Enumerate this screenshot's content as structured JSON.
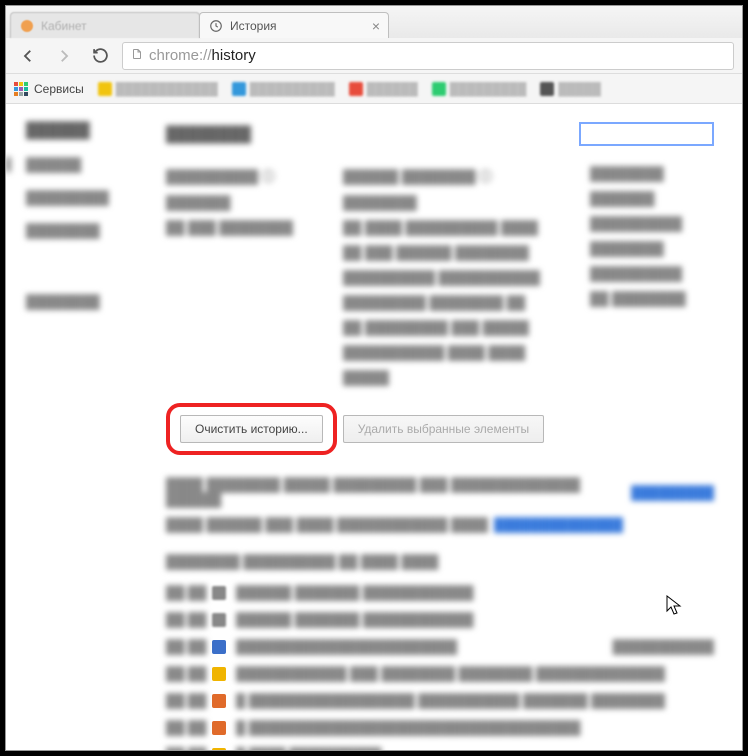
{
  "tabs": [
    {
      "title": "Кабинет",
      "active": false
    },
    {
      "title": "История",
      "active": true
    }
  ],
  "toolbar": {
    "url_prefix": "chrome://",
    "url_path": "history"
  },
  "bookmarks": {
    "services_label": "Сервисы",
    "items": [
      {
        "color": "#f1c40f"
      },
      {
        "color": "#3498db"
      },
      {
        "color": "#e74c3c"
      },
      {
        "color": "#2ecc71"
      },
      {
        "color": "#555555"
      }
    ]
  },
  "page": {
    "buttons": {
      "clear_history": "Очистить историю...",
      "delete_selected": "Удалить выбранные элементы"
    },
    "search_placeholder": "",
    "history_icons": [
      "#3b6fc9",
      "#f0b400",
      "#e06a2a",
      "#e06a2a",
      "#f0b400"
    ]
  }
}
